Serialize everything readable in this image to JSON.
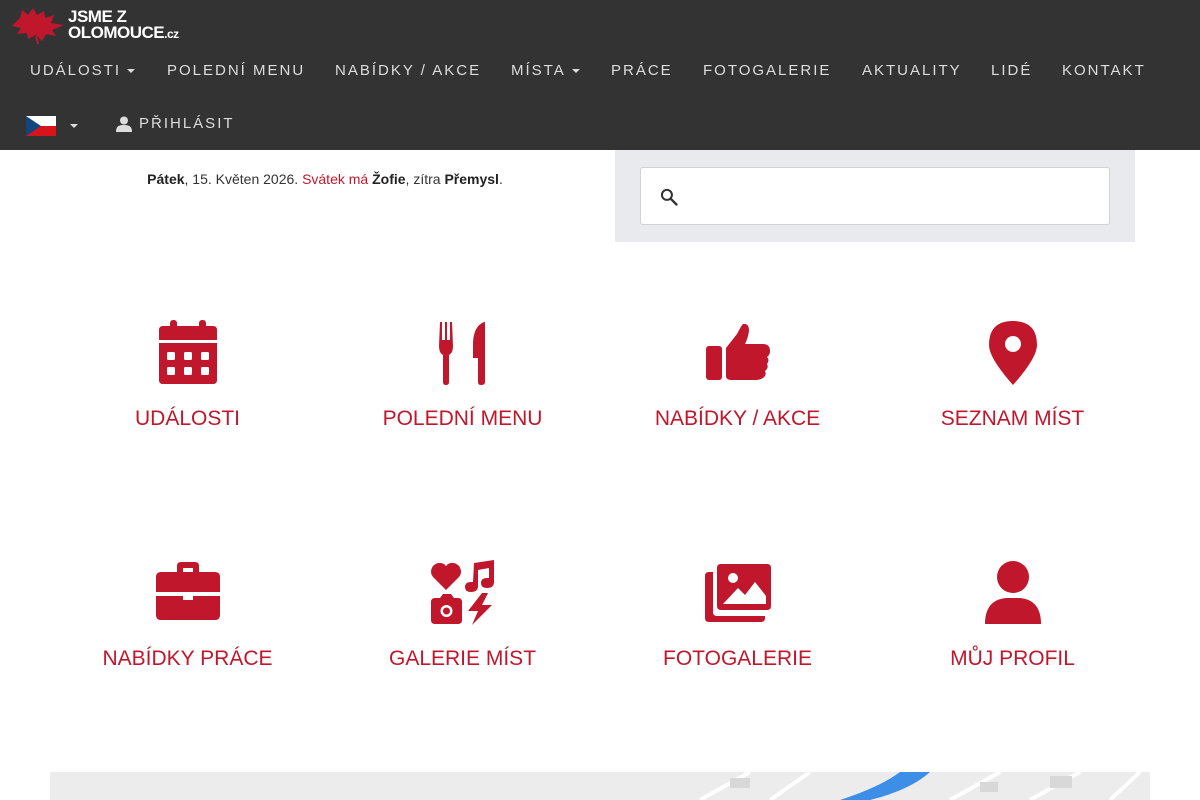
{
  "brand": {
    "logo_line1": "JSME Z",
    "logo_line2": "OLOMOUCE",
    "logo_tld": ".cz",
    "accent_color": "#c0172c",
    "navbar_color": "#333333"
  },
  "nav": {
    "items": [
      {
        "label": "UDÁLOSTI",
        "dropdown": true
      },
      {
        "label": "POLEDNÍ MENU",
        "dropdown": false
      },
      {
        "label": "NABÍDKY / AKCE",
        "dropdown": false
      },
      {
        "label": "MÍSTA",
        "dropdown": true
      },
      {
        "label": "PRÁCE",
        "dropdown": false
      },
      {
        "label": "FOTOGALERIE",
        "dropdown": false
      },
      {
        "label": "AKTUALITY",
        "dropdown": false
      },
      {
        "label": "LIDÉ",
        "dropdown": false
      },
      {
        "label": "KONTAKT",
        "dropdown": false
      }
    ],
    "language_flag": "czech-flag-icon",
    "login_label": "PŘIHLÁSIT"
  },
  "dateline": {
    "day": "Pátek",
    "date": ", 15. Květen 2026. ",
    "nameday_prefix": "Svátek má ",
    "nameday_name": "Žofie",
    "tomorrow_prefix": ", zítra ",
    "tomorrow_name": "Přemysl",
    "end": "."
  },
  "search": {
    "icon": "search-icon",
    "value": "",
    "placeholder": ""
  },
  "tiles": [
    {
      "label": "UDÁLOSTI",
      "icon": "calendar-icon"
    },
    {
      "label": "POLEDNÍ MENU",
      "icon": "utensils-icon"
    },
    {
      "label": "NABÍDKY / AKCE",
      "icon": "thumbs-up-icon"
    },
    {
      "label": "SEZNAM MÍST",
      "icon": "map-pin-icon"
    },
    {
      "label": "NABÍDKY PRÁCE",
      "icon": "briefcase-icon"
    },
    {
      "label": "GALERIE MÍST",
      "icon": "icons-collage-icon"
    },
    {
      "label": "FOTOGALERIE",
      "icon": "images-icon"
    },
    {
      "label": "MŮJ PROFIL",
      "icon": "user-icon"
    }
  ]
}
